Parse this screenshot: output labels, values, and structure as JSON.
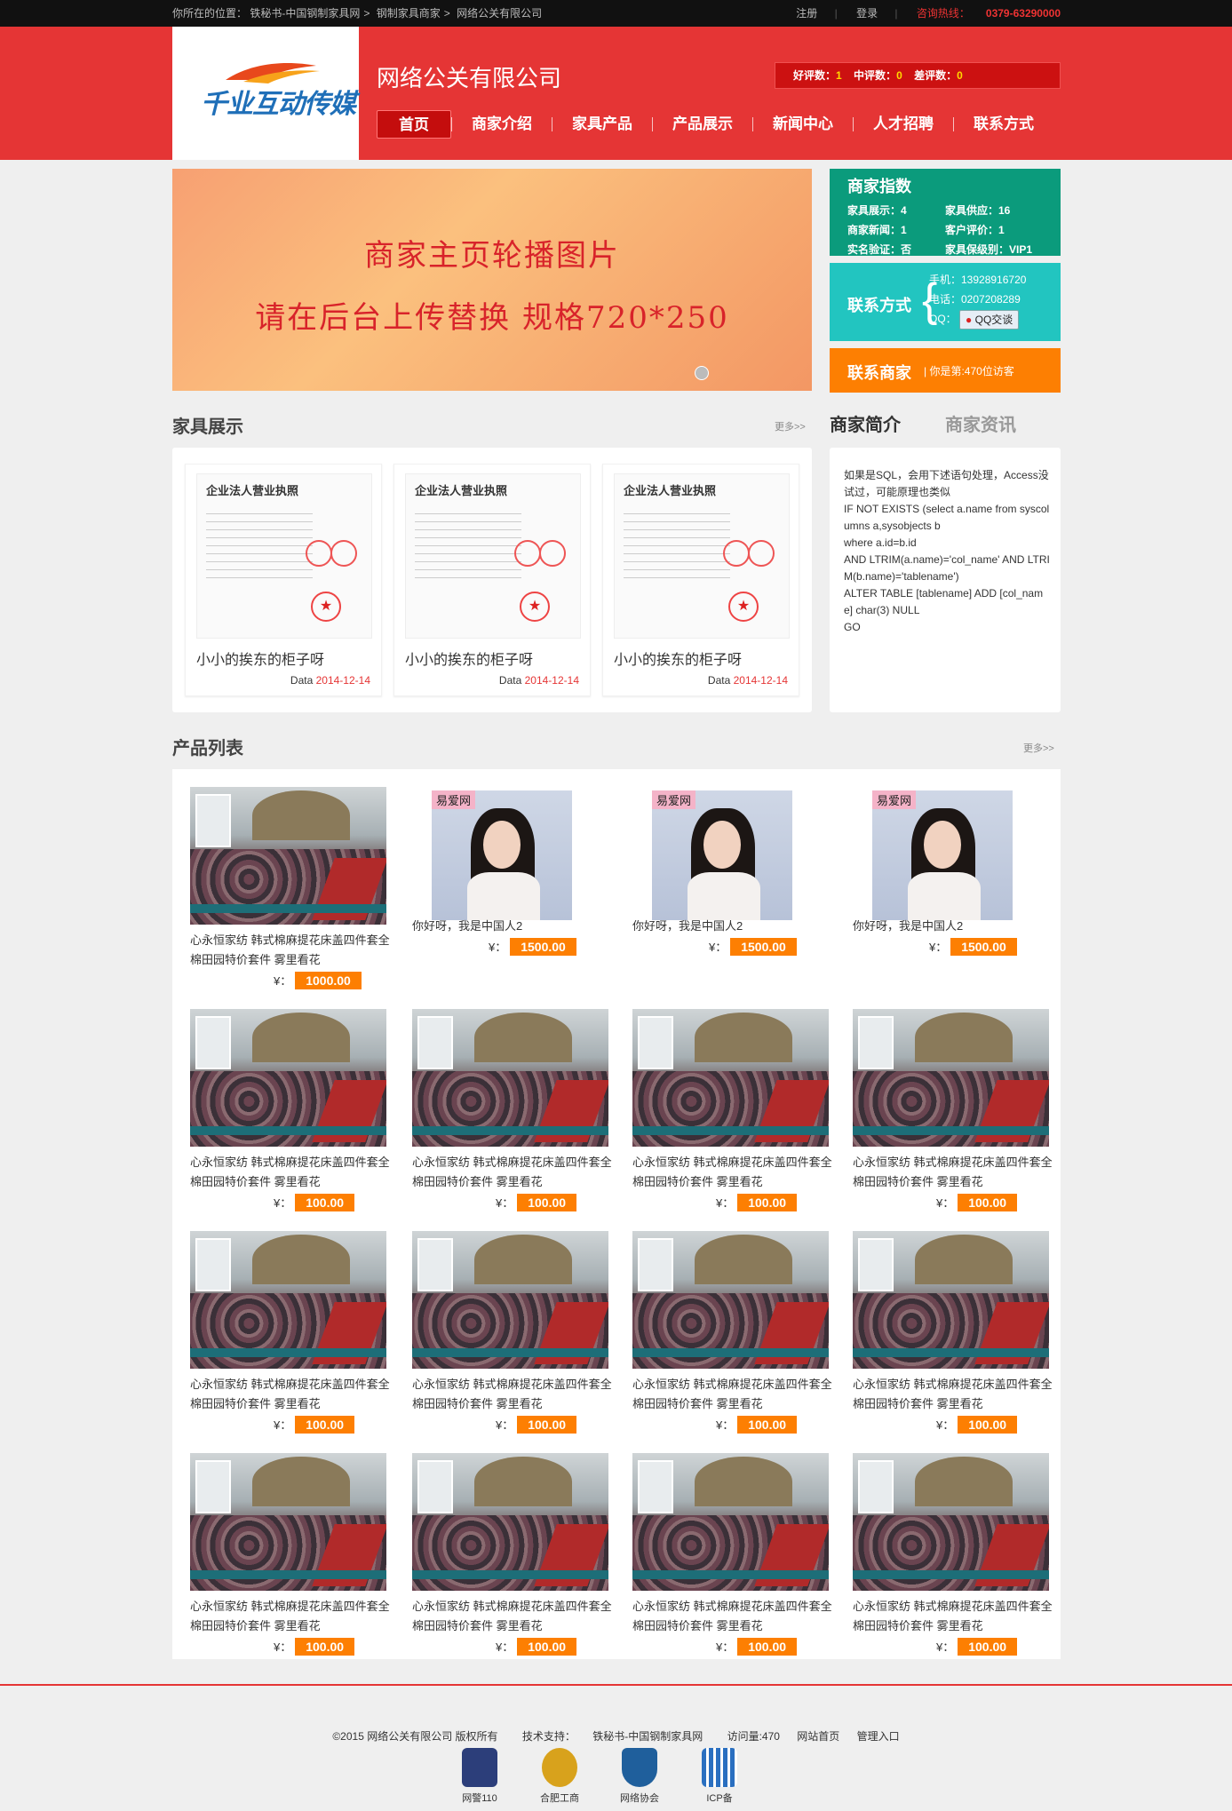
{
  "topbar": {
    "crumbs": [
      "你所在的位置：",
      "铁秘书-中国钢制家具网",
      "钢制家具商家",
      "网络公关有限公司"
    ],
    "register": "注册",
    "login": "登录",
    "hotline_label": "咨询热线：",
    "hotline_number": "0379-63290000"
  },
  "header": {
    "logo_text": "千业互动传媒",
    "company_name": "网络公关有限公司",
    "rating": {
      "good_label": "好评数：",
      "good": "1",
      "mid_label": "中评数：",
      "mid": "0",
      "bad_label": "差评数：",
      "bad": "0"
    },
    "nav": [
      "首页",
      "商家介绍",
      "家具产品",
      "产品展示",
      "新闻中心",
      "人才招聘",
      "联系方式"
    ]
  },
  "banner": {
    "line1": "商家主页轮播图片",
    "line2": "请在后台上传替换 规格720*250"
  },
  "merchant_index": {
    "title": "商家指数",
    "rows": [
      [
        "家具展示：4",
        "家具供应：16"
      ],
      [
        "商家新闻：1",
        "客户评价：1"
      ],
      [
        "实名验证：否",
        "家具保级别：VIP1"
      ]
    ]
  },
  "contact": {
    "label": "联系方式",
    "mobile": "手机：13928916720",
    "phone": "电话：0207208289",
    "qq_label": "QQ：",
    "qq_button": "QQ交谈"
  },
  "merchant_link": {
    "label": "联系商家",
    "sub": "你是第:470位访客"
  },
  "furniture": {
    "title": "家具展示",
    "more": "更多>>",
    "cert_title": "企业法人营业执照",
    "items": [
      {
        "name": "小小的挨东的柜子呀",
        "date_label": "Data",
        "date": "2014-12-14"
      },
      {
        "name": "小小的挨东的柜子呀",
        "date_label": "Data",
        "date": "2014-12-14"
      },
      {
        "name": "小小的挨东的柜子呀",
        "date_label": "Data",
        "date": "2014-12-14"
      }
    ]
  },
  "intro": {
    "tab_active": "商家简介",
    "tab_other": "商家资讯",
    "text": "如果是SQL，会用下述语句处理，Access没试过，可能原理也类似\nIF NOT EXISTS (select a.name from syscolumns a,sysobjects b\nwhere a.id=b.id\nAND LTRIM(a.name)='col_name' AND LTRIM(b.name)='tablename')\nALTER TABLE [tablename] ADD [col_name] char(3) NULL\nGO"
  },
  "products": {
    "title": "产品列表",
    "more": "更多>>",
    "currency": "¥：",
    "portrait_tag": "易爱网",
    "items": [
      {
        "kind": "bed",
        "name": "心永恒家纺 韩式棉麻提花床盖四件套全棉田园特价套件 雾里看花",
        "price": "1000.00"
      },
      {
        "kind": "portrait",
        "name": "你好呀，我是中国人2",
        "price": "1500.00"
      },
      {
        "kind": "portrait",
        "name": "你好呀，我是中国人2",
        "price": "1500.00"
      },
      {
        "kind": "portrait",
        "name": "你好呀，我是中国人2",
        "price": "1500.00"
      },
      {
        "kind": "bed",
        "name": "心永恒家纺 韩式棉麻提花床盖四件套全棉田园特价套件 雾里看花",
        "price": "100.00"
      },
      {
        "kind": "bed",
        "name": "心永恒家纺 韩式棉麻提花床盖四件套全棉田园特价套件 雾里看花",
        "price": "100.00"
      },
      {
        "kind": "bed",
        "name": "心永恒家纺 韩式棉麻提花床盖四件套全棉田园特价套件 雾里看花",
        "price": "100.00"
      },
      {
        "kind": "bed",
        "name": "心永恒家纺 韩式棉麻提花床盖四件套全棉田园特价套件 雾里看花",
        "price": "100.00"
      },
      {
        "kind": "bed",
        "name": "心永恒家纺 韩式棉麻提花床盖四件套全棉田园特价套件 雾里看花",
        "price": "100.00"
      },
      {
        "kind": "bed",
        "name": "心永恒家纺 韩式棉麻提花床盖四件套全棉田园特价套件 雾里看花",
        "price": "100.00"
      },
      {
        "kind": "bed",
        "name": "心永恒家纺 韩式棉麻提花床盖四件套全棉田园特价套件 雾里看花",
        "price": "100.00"
      },
      {
        "kind": "bed",
        "name": "心永恒家纺 韩式棉麻提花床盖四件套全棉田园特价套件 雾里看花",
        "price": "100.00"
      },
      {
        "kind": "bed",
        "name": "心永恒家纺 韩式棉麻提花床盖四件套全棉田园特价套件 雾里看花",
        "price": "100.00"
      },
      {
        "kind": "bed",
        "name": "心永恒家纺 韩式棉麻提花床盖四件套全棉田园特价套件 雾里看花",
        "price": "100.00"
      },
      {
        "kind": "bed",
        "name": "心永恒家纺 韩式棉麻提花床盖四件套全棉田园特价套件 雾里看花",
        "price": "100.00"
      },
      {
        "kind": "bed",
        "name": "心永恒家纺 韩式棉麻提花床盖四件套全棉田园特价套件 雾里看花",
        "price": "100.00"
      }
    ]
  },
  "footer": {
    "copyright": "©2015 网络公关有限公司 版权所有",
    "support_label": "技术支持：",
    "support_link": "铁秘书-中国钢制家具网",
    "visits": "访问量:470",
    "home_link": "网站首页",
    "admin_link": "管理入口",
    "badges": [
      {
        "label": "网警110",
        "icon": "police-badge-icon"
      },
      {
        "label": "合肥工商",
        "icon": "commerce-emblem-icon"
      },
      {
        "label": "网络协会",
        "icon": "association-shield-icon"
      },
      {
        "label": "ICP备",
        "icon": "icp-icon"
      }
    ]
  },
  "colors": {
    "brand_red": "#e53535",
    "green": "#0b9b7c",
    "teal": "#22c5c0",
    "orange": "#fd7f02"
  }
}
